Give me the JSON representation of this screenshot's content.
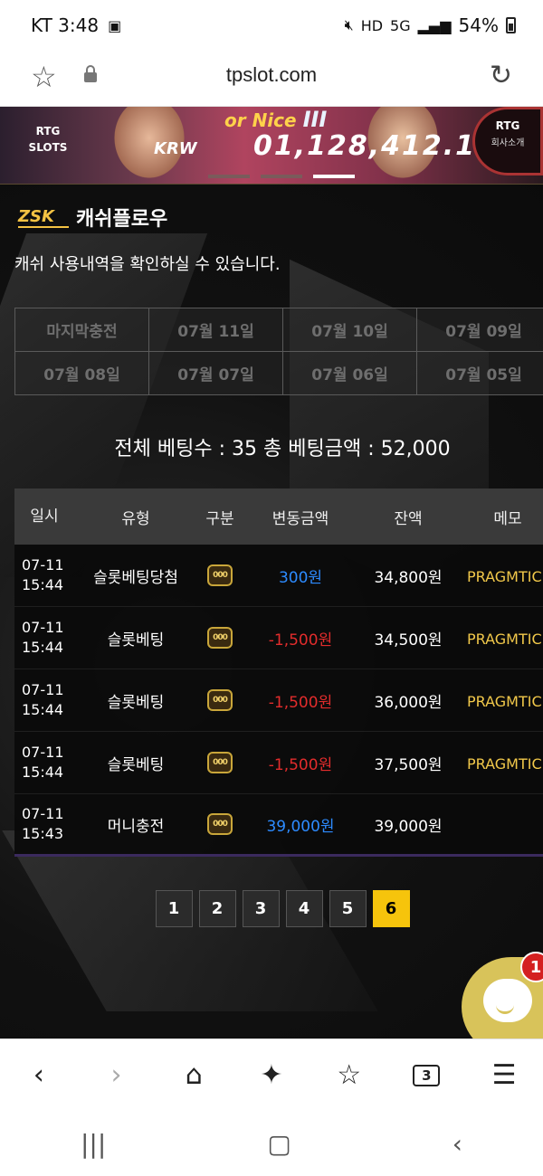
{
  "status": {
    "carrier_time": "KT 3:48",
    "battery": "54%",
    "net": "5G"
  },
  "browser": {
    "url": "tpslot.com"
  },
  "banner": {
    "left_logo": "RTG SLOTS",
    "promo": "or Nice",
    "promo_big": "III",
    "currency": "KRW",
    "jackpot": "01,128,412.1",
    "right_logo": "RTG",
    "right_sub": "회사소개"
  },
  "header": {
    "logo_text": "ZSK",
    "title": "캐쉬플로우",
    "subtitle": "캐쉬 사용내역을 확인하실 수 있습니다."
  },
  "dates": [
    "마지막충전",
    "07월 11일",
    "07월 10일",
    "07월 09일",
    "07월 08일",
    "07월 07일",
    "07월 06일",
    "07월 05일"
  ],
  "summary": "전체 베팅수 : 35   총 베팅금액 : 52,000",
  "table": {
    "headers": [
      "일시",
      "유형",
      "구분",
      "변동금액",
      "잔액",
      "메모"
    ],
    "rows": [
      {
        "date": "07-11",
        "time": "15:44",
        "type": "슬롯베팅당첨",
        "amount": "300원",
        "amount_sign": "pos",
        "balance": "34,800원",
        "memo": "PRAGMTIC:핀"
      },
      {
        "date": "07-11",
        "time": "15:44",
        "type": "슬롯베팅",
        "amount": "-1,500원",
        "amount_sign": "neg",
        "balance": "34,500원",
        "memo": "PRAGMTIC:핀"
      },
      {
        "date": "07-11",
        "time": "15:44",
        "type": "슬롯베팅",
        "amount": "-1,500원",
        "amount_sign": "neg",
        "balance": "36,000원",
        "memo": "PRAGMTIC:핀"
      },
      {
        "date": "07-11",
        "time": "15:44",
        "type": "슬롯베팅",
        "amount": "-1,500원",
        "amount_sign": "neg",
        "balance": "37,500원",
        "memo": "PRAGMTIC:핀"
      },
      {
        "date": "07-11",
        "time": "15:43",
        "type": "머니충전",
        "amount": "39,000원",
        "amount_sign": "pos",
        "balance": "39,000원",
        "memo": ""
      }
    ],
    "kind_icon": "slot-machine-icon",
    "kind_icon_text": "000"
  },
  "pagination": {
    "pages": [
      "1",
      "2",
      "3",
      "4",
      "5",
      "6"
    ],
    "active": "6"
  },
  "chat": {
    "badge": "1"
  },
  "browser_nav": {
    "tabs_count": "3"
  },
  "colors": {
    "accent": "#f6c40c",
    "positive": "#2d8bff",
    "negative": "#e22c2c",
    "memo": "#f1c84a"
  }
}
